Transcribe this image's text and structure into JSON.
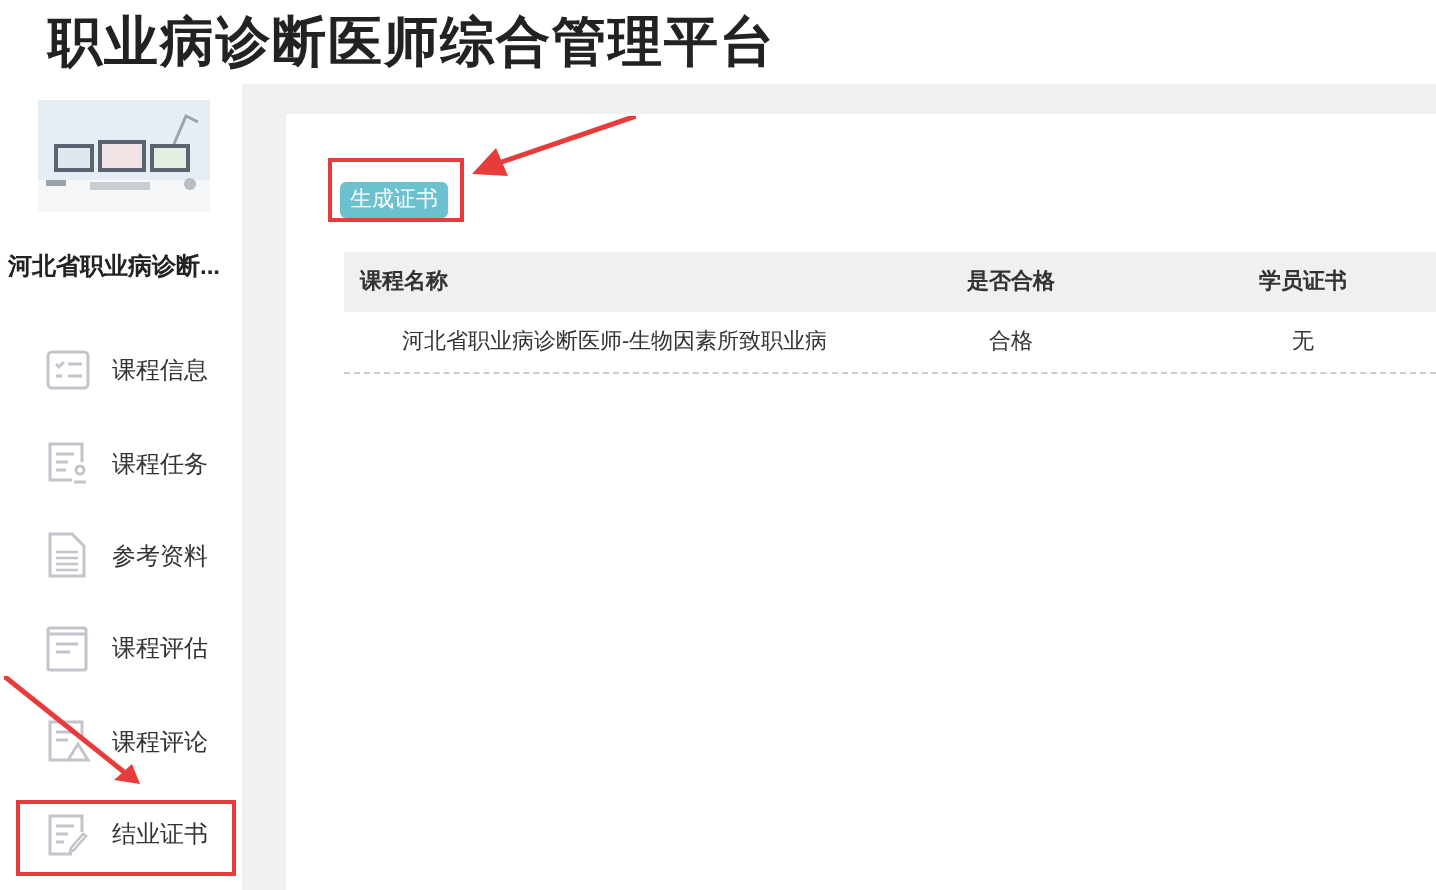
{
  "header": {
    "title": "职业病诊断医师综合管理平台"
  },
  "sidebar": {
    "course_title": "河北省职业病诊断...",
    "items": [
      {
        "label": "课程信息",
        "kind": "checklist"
      },
      {
        "label": "课程任务",
        "kind": "task"
      },
      {
        "label": "参考资料",
        "kind": "document"
      },
      {
        "label": "课程评估",
        "kind": "form"
      },
      {
        "label": "课程评论",
        "kind": "warning"
      },
      {
        "label": "结业证书",
        "kind": "edit"
      }
    ]
  },
  "main": {
    "button": "生成证书",
    "table": {
      "columns": [
        "课程名称",
        "是否合格",
        "学员证书"
      ],
      "rows": [
        [
          "河北省职业病诊断医师-生物因素所致职业病",
          "合格",
          "无"
        ]
      ]
    }
  }
}
